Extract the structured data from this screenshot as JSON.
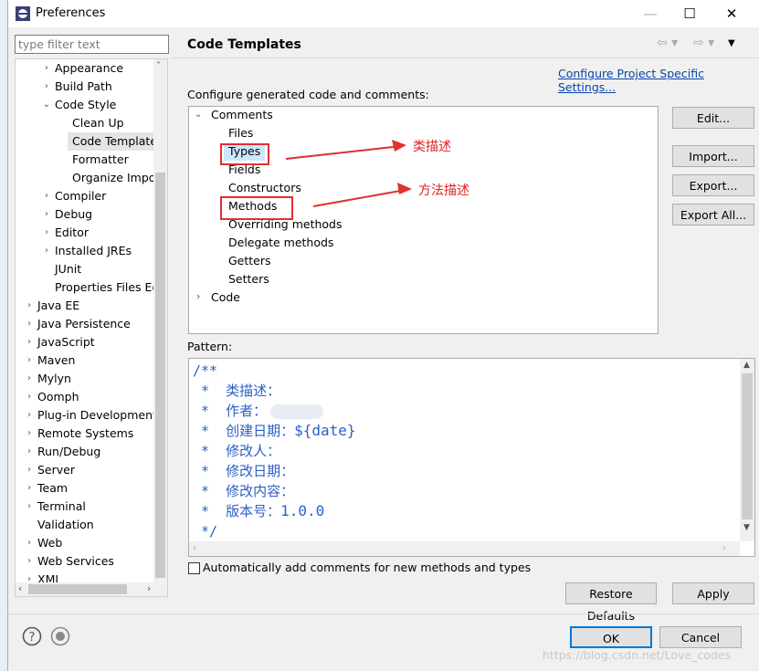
{
  "window": {
    "title": "Preferences",
    "minimize": "—",
    "maximize": "☐",
    "close": "✕"
  },
  "filter": {
    "placeholder": "type filter text"
  },
  "tree": {
    "items": [
      {
        "label": "Appearance",
        "arrow": "›"
      },
      {
        "label": "Build Path",
        "arrow": "›"
      },
      {
        "label": "Code Style",
        "arrow": "⌄"
      },
      {
        "label": "Clean Up",
        "arrow": ""
      },
      {
        "label": "Code Template",
        "arrow": ""
      },
      {
        "label": "Formatter",
        "arrow": ""
      },
      {
        "label": "Organize Impo",
        "arrow": ""
      },
      {
        "label": "Compiler",
        "arrow": "›"
      },
      {
        "label": "Debug",
        "arrow": "›"
      },
      {
        "label": "Editor",
        "arrow": "›"
      },
      {
        "label": "Installed JREs",
        "arrow": "›"
      },
      {
        "label": "JUnit",
        "arrow": ""
      },
      {
        "label": "Properties Files Ed",
        "arrow": ""
      },
      {
        "label": "Java EE",
        "arrow": "›"
      },
      {
        "label": "Java Persistence",
        "arrow": "›"
      },
      {
        "label": "JavaScript",
        "arrow": "›"
      },
      {
        "label": "Maven",
        "arrow": "›"
      },
      {
        "label": "Mylyn",
        "arrow": "›"
      },
      {
        "label": "Oomph",
        "arrow": "›"
      },
      {
        "label": "Plug-in Development",
        "arrow": "›"
      },
      {
        "label": "Remote Systems",
        "arrow": "›"
      },
      {
        "label": "Run/Debug",
        "arrow": "›"
      },
      {
        "label": "Server",
        "arrow": "›"
      },
      {
        "label": "Team",
        "arrow": "›"
      },
      {
        "label": "Terminal",
        "arrow": "›"
      },
      {
        "label": "Validation",
        "arrow": ""
      },
      {
        "label": "Web",
        "arrow": "›"
      },
      {
        "label": "Web Services",
        "arrow": "›"
      },
      {
        "label": "XML",
        "arrow": "›"
      }
    ]
  },
  "page": {
    "title": "Code Templates",
    "configure_link": "Configure Project Specific Settings...",
    "description": "Configure generated code and comments:",
    "pattern_label": "Pattern:",
    "auto_comment_label": "Automatically add comments for new methods and types"
  },
  "templates": {
    "comments": "Comments",
    "files": "Files",
    "types": "Types",
    "fields": "Fields",
    "constructors": "Constructors",
    "methods": "Methods",
    "overriding": "Overriding methods",
    "delegate": "Delegate methods",
    "getters": "Getters",
    "setters": "Setters",
    "code": "Code"
  },
  "side_buttons": {
    "edit": "Edit...",
    "import": "Import...",
    "export": "Export...",
    "export_all": "Export All..."
  },
  "annotations": {
    "types_note": "类描述",
    "methods_note": "方法描述"
  },
  "pattern_lines": {
    "l1": "/**",
    "l2": " *  类描述：",
    "l3": " *  作者：",
    "l4a": " *  创建日期：",
    "l4b": "${date}",
    "l5": " *  修改人：",
    "l6": " *  修改日期：",
    "l7": " *  修改内容：",
    "l8a": " *  版本号：",
    "l8b": "1.0.0",
    "l9": " */"
  },
  "footer": {
    "restore": "Restore Defaults",
    "apply": "Apply",
    "ok": "OK",
    "cancel": "Cancel",
    "watermark": "https://blog.csdn.net/Love_codes"
  },
  "colors": {
    "annotation": "#e02020",
    "code": "#2b5fc7",
    "link": "#0645ad"
  }
}
